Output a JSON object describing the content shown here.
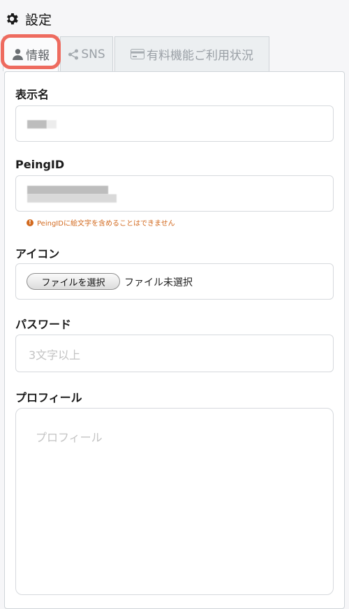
{
  "header": {
    "icon": "gear-icon",
    "title": "設定"
  },
  "tabs": [
    {
      "label": "情報",
      "icon": "user-icon",
      "active": true
    },
    {
      "label": "SNS",
      "icon": "share-icon",
      "active": false
    },
    {
      "label": "有料機能ご利用状況",
      "icon": "credit-card-icon",
      "active": false
    }
  ],
  "form": {
    "display_name": {
      "label": "表示名",
      "value": ""
    },
    "peing_id": {
      "label": "PeingID",
      "value": "",
      "warning": "PeingIDに絵文字を含めることはできません",
      "warning_icon": "exclamation-icon"
    },
    "icon": {
      "label": "アイコン",
      "button_label": "ファイルを選択",
      "status": "ファイル未選択"
    },
    "password": {
      "label": "パスワード",
      "placeholder": "3文字以上"
    },
    "profile": {
      "label": "プロフィール",
      "placeholder": "プロフィール"
    }
  },
  "colors": {
    "highlight": "#ee6b5f",
    "warning": "#d2691e"
  }
}
